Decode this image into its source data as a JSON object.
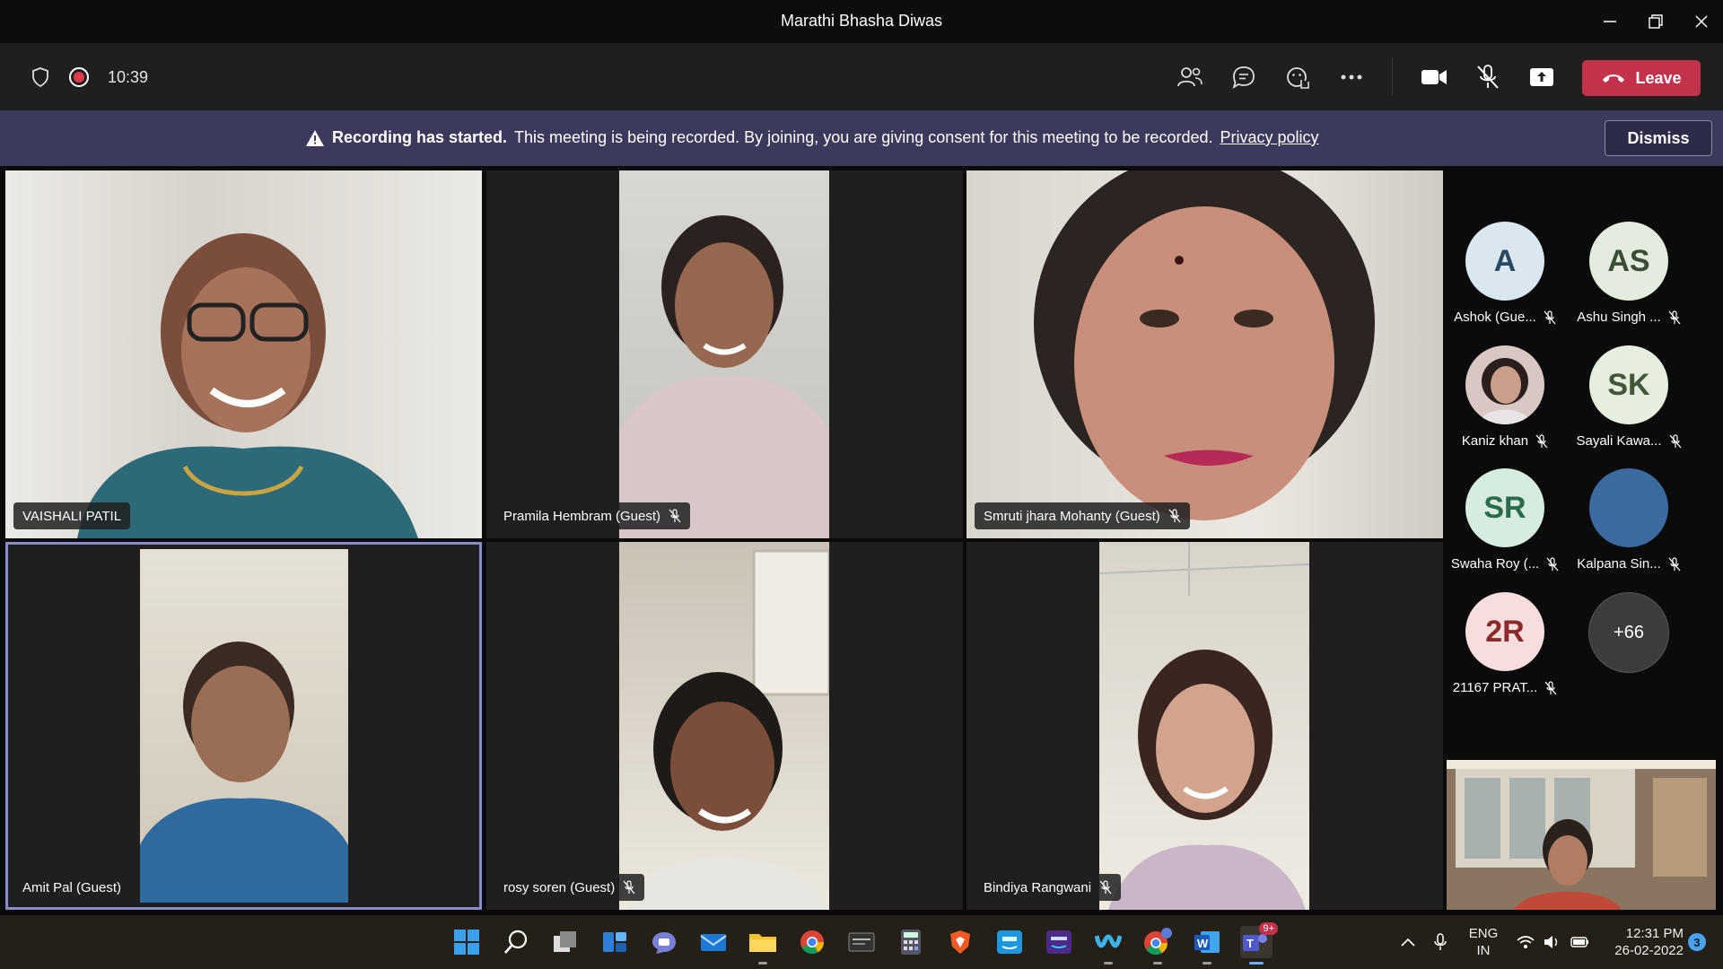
{
  "window": {
    "title": "Marathi Bhasha Diwas"
  },
  "toolbar": {
    "timer": "10:39",
    "leave_label": "Leave"
  },
  "banner": {
    "bold": "Recording has started.",
    "text": "This meeting is being recorded. By joining, you are giving consent for this meeting to be recorded.",
    "link": "Privacy policy",
    "dismiss_label": "Dismiss"
  },
  "tiles": [
    {
      "name": "VAISHALI PATIL"
    },
    {
      "name": "Pramila Hembram (Guest)"
    },
    {
      "name": "Smruti jhara Mohanty (Guest)"
    },
    {
      "name": "Amit Pal (Guest)"
    },
    {
      "name": "rosy soren (Guest)"
    },
    {
      "name": "Bindiya Rangwani"
    }
  ],
  "roster": [
    {
      "initials": "A",
      "name": "Ashok (Gue...",
      "color": "#dbe7ef",
      "text_color": "#2a4a62"
    },
    {
      "initials": "AS",
      "name": "Ashu Singh ...",
      "color": "#e3ecdf",
      "text_color": "#3c4d36"
    },
    {
      "initials": "",
      "name": "Kaniz khan",
      "color": "#d9c7c4",
      "text_color": "#333"
    },
    {
      "initials": "SK",
      "name": "Sayali Kawa...",
      "color": "#e6efdd",
      "text_color": "#44563a"
    },
    {
      "initials": "SR",
      "name": "Swaha Roy (...",
      "color": "#d6ecdf",
      "text_color": "#2c6a4a"
    },
    {
      "initials": "",
      "name": "Kalpana Sin...",
      "color": "#3a6aa0",
      "text_color": "#fff"
    },
    {
      "initials": "2R",
      "name": "21167 PRAT...",
      "color": "#f7dede",
      "text_color": "#8a2a2a"
    },
    {
      "initials": "+66",
      "name": "",
      "color": "#3c3c3c",
      "text_color": "#fff"
    }
  ],
  "taskbar": {
    "lang_top": "ENG",
    "lang_bottom": "IN",
    "time": "12:31 PM",
    "date": "26-02-2022",
    "notif_count": "3",
    "teams_badge": "9+"
  }
}
